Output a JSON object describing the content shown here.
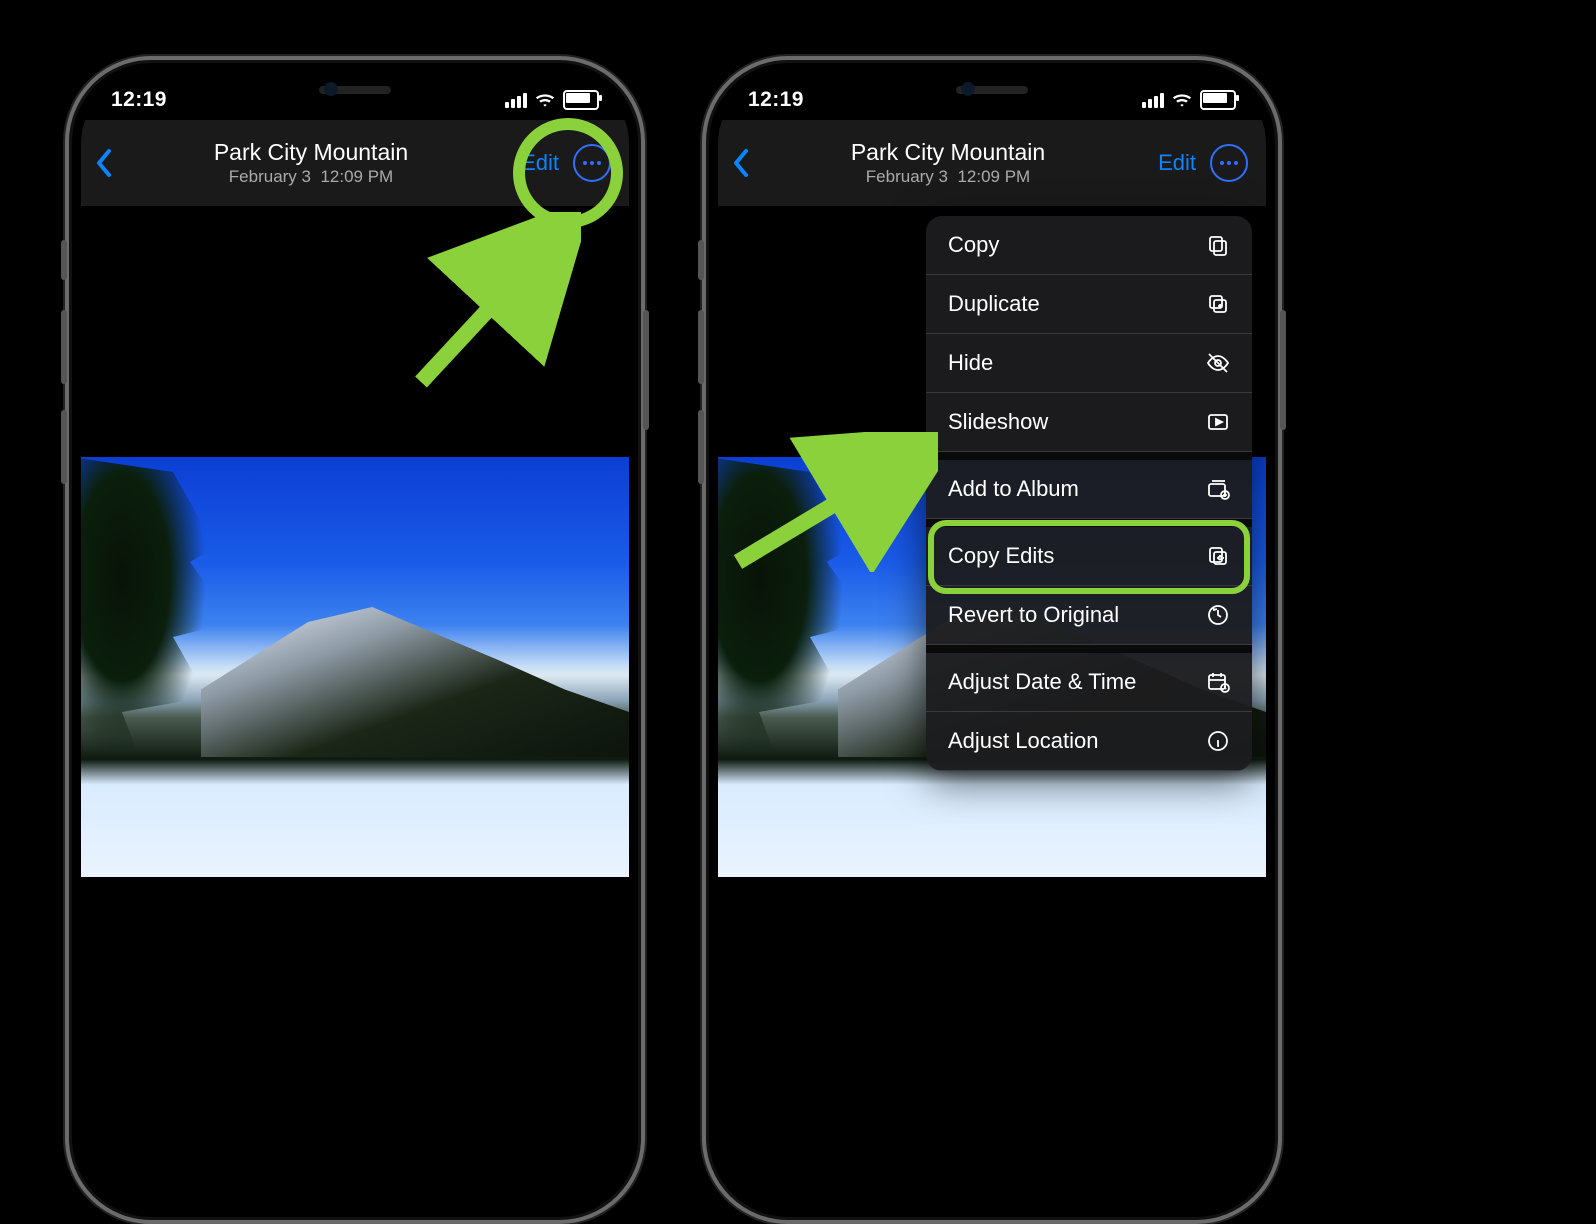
{
  "status": {
    "time": "12:19"
  },
  "nav": {
    "title": "Park City Mountain",
    "subtitle_date": "February 3",
    "subtitle_time": "12:09 PM",
    "edit": "Edit"
  },
  "menu": {
    "items": [
      {
        "key": "copy",
        "label": "Copy"
      },
      {
        "key": "duplicate",
        "label": "Duplicate"
      },
      {
        "key": "hide",
        "label": "Hide"
      },
      {
        "key": "slideshow",
        "label": "Slideshow"
      },
      {
        "key": "addtoalbum",
        "label": "Add to Album"
      },
      {
        "key": "copyedits",
        "label": "Copy Edits"
      },
      {
        "key": "revert",
        "label": "Revert to Original"
      },
      {
        "key": "adjustdatetime",
        "label": "Adjust Date & Time"
      },
      {
        "key": "adjustlocation",
        "label": "Adjust Location"
      }
    ]
  }
}
